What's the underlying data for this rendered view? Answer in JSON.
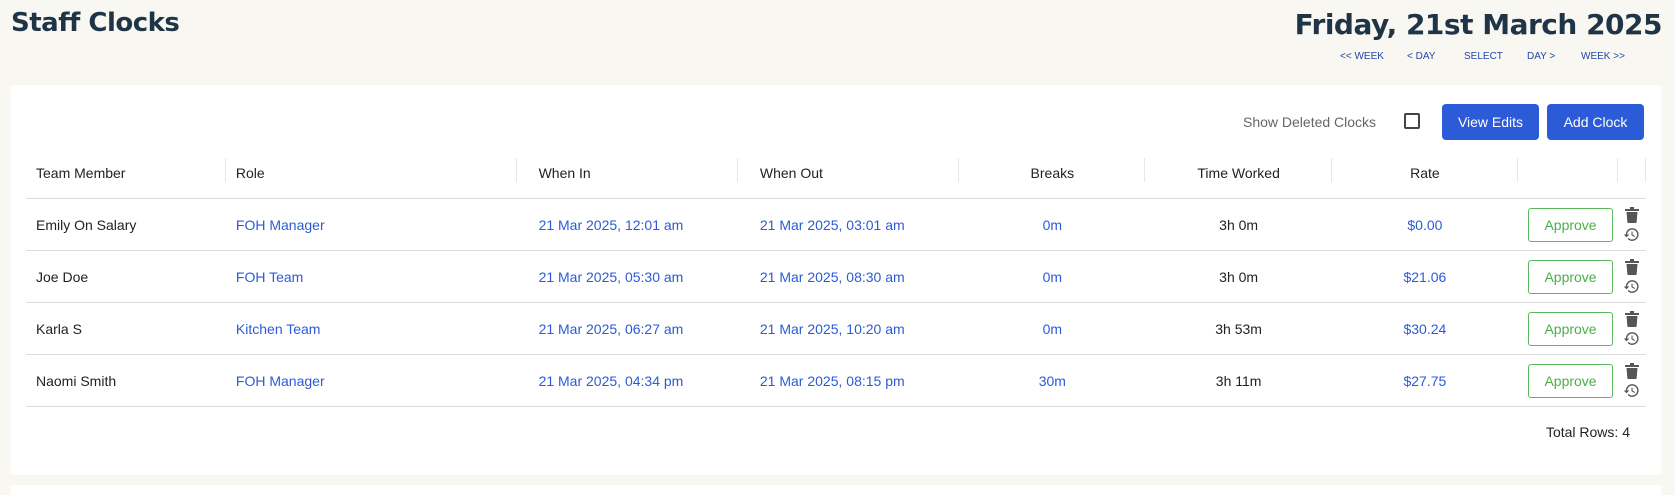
{
  "header": {
    "title": "Staff Clocks",
    "date": "Friday, 21st March 2025",
    "nav": {
      "prev_week": "<< WEEK",
      "prev_day": "< DAY",
      "select": "SELECT",
      "next_day": "DAY >",
      "next_week": "WEEK >>"
    }
  },
  "toolbar": {
    "show_deleted_label": "Show Deleted Clocks",
    "show_deleted_checked": false,
    "view_edits_label": "View Edits",
    "add_clock_label": "Add Clock"
  },
  "table": {
    "columns": {
      "team_member": "Team Member",
      "role": "Role",
      "when_in": "When In",
      "when_out": "When Out",
      "breaks": "Breaks",
      "time_worked": "Time Worked",
      "rate": "Rate"
    },
    "rows": [
      {
        "name": "Emily On Salary",
        "role": "FOH Manager",
        "when_in": "21 Mar 2025, 12:01 am",
        "when_out": "21 Mar 2025, 03:01 am",
        "breaks": "0m",
        "time_worked": "3h 0m",
        "rate": "$0.00",
        "action": "Approve"
      },
      {
        "name": "Joe Doe",
        "role": "FOH Team",
        "when_in": "21 Mar 2025, 05:30 am",
        "when_out": "21 Mar 2025, 08:30 am",
        "breaks": "0m",
        "time_worked": "3h 0m",
        "rate": "$21.06",
        "action": "Approve"
      },
      {
        "name": "Karla S",
        "role": "Kitchen Team",
        "when_in": "21 Mar 2025, 06:27 am",
        "when_out": "21 Mar 2025, 10:20 am",
        "breaks": "0m",
        "time_worked": "3h 53m",
        "rate": "$30.24",
        "action": "Approve"
      },
      {
        "name": "Naomi Smith",
        "role": "FOH Manager",
        "when_in": "21 Mar 2025, 04:34 pm",
        "when_out": "21 Mar 2025, 08:15 pm",
        "breaks": "30m",
        "time_worked": "3h 11m",
        "rate": "$27.75",
        "action": "Approve"
      }
    ],
    "total_rows": "Total Rows: 4"
  },
  "icons": {
    "delete": "trash-icon",
    "history": "history-icon"
  },
  "colors": {
    "title": "#1f3547",
    "nav_link": "#2446a8",
    "primary_button": "#2b5bd7",
    "link": "#2b5bd7",
    "approve": "#5cb85c"
  }
}
